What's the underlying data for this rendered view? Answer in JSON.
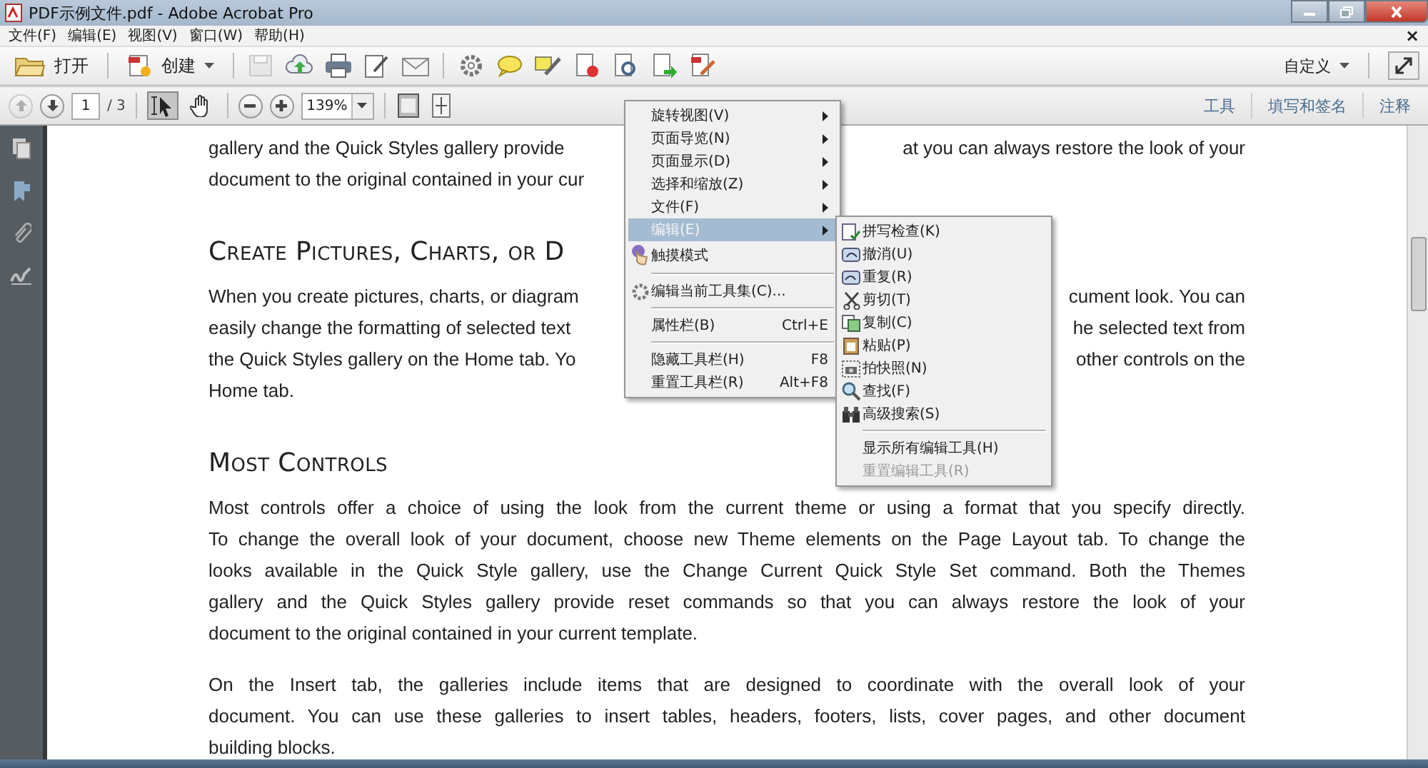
{
  "window": {
    "title": "PDF示例文件.pdf - Adobe Acrobat Pro"
  },
  "menu_bar": {
    "items": [
      "文件(F)",
      "编辑(E)",
      "视图(V)",
      "窗口(W)",
      "帮助(H)"
    ],
    "close_glyph": "×"
  },
  "toolbar": {
    "open_label": "打开",
    "create_label": "创建",
    "tools": [
      {
        "kind": "save",
        "disabled": true
      },
      {
        "kind": "cloud"
      },
      {
        "kind": "print"
      },
      {
        "kind": "sign"
      },
      {
        "kind": "mail"
      },
      {
        "kind": "gear"
      },
      {
        "kind": "comment"
      },
      {
        "kind": "highlight"
      },
      {
        "kind": "pdf-remove"
      },
      {
        "kind": "pdf-search"
      },
      {
        "kind": "pdf-export"
      },
      {
        "kind": "pdf-edit"
      }
    ],
    "customize_label": "自定义"
  },
  "nav_toolbar": {
    "prev_disabled": true,
    "page": "1",
    "page_total": "/ 3",
    "tools": [
      {
        "kind": "select",
        "selected": true
      },
      {
        "kind": "hand",
        "selected": false
      }
    ],
    "zoom": "139%",
    "panes": [
      {
        "label": "工具"
      },
      {
        "label": "填写和签名"
      },
      {
        "label": "注释"
      }
    ]
  },
  "document": {
    "blocks": [
      {
        "kind": "paragraph",
        "lines": [
          {
            "left": "gallery and the Quick Styles gallery provide",
            "right": "at you can always restore the look of your"
          },
          {
            "left": "document to the original contained in your cur"
          }
        ]
      },
      {
        "kind": "heading",
        "text": "Create Pictures, Charts, or D"
      },
      {
        "kind": "paragraph",
        "lines": [
          {
            "left": "When you create pictures, charts, or diagram",
            "right": "cument look. You can"
          },
          {
            "left": "easily change the formatting of selected text",
            "right": "he selected text from"
          },
          {
            "left": "the Quick Styles gallery on the Home tab. Yo",
            "right": "other controls on the"
          },
          {
            "left": "Home tab."
          }
        ]
      },
      {
        "kind": "heading",
        "text": "Most Controls"
      },
      {
        "kind": "paragraph",
        "lines": [
          {
            "left": "Most controls offer a choice of using the look from the current theme or using a format that you specify directly.",
            "justified": true
          },
          {
            "left": "To change the overall look of your document, choose new Theme elements on the Page Layout tab. To change the",
            "justified": true
          },
          {
            "left": "looks available in the Quick Style gallery, use the Change Current Quick Style Set command. Both the Themes",
            "justified": true
          },
          {
            "left": "gallery and the Quick Styles gallery provide reset commands so that you can always restore the look of your",
            "justified": true
          },
          {
            "left": "document to the original contained in your current template.",
            "justified": false
          }
        ]
      },
      {
        "kind": "paragraph",
        "lines": [
          {
            "left": "On the Insert tab, the galleries include items that are designed to coordinate with the overall look of your",
            "justified": true
          },
          {
            "left": "document. You can use these galleries to insert tables, headers, footers, lists, cover pages, and other document",
            "justified": true
          },
          {
            "left": "building blocks.",
            "justified": false
          }
        ]
      }
    ]
  },
  "context_menu": {
    "groups": [
      [
        {
          "label": "旋转视图(V)",
          "submenu": true,
          "selected": false
        },
        {
          "label": "页面导览(N)",
          "submenu": true,
          "selected": false
        },
        {
          "label": "页面显示(D)",
          "submenu": true,
          "selected": false
        },
        {
          "label": "选择和缩放(Z)",
          "submenu": true,
          "selected": false
        },
        {
          "label": "文件(F)",
          "submenu": true,
          "selected": false
        },
        {
          "label": "编辑(E)",
          "submenu": true,
          "selected": true
        },
        {
          "label": "触摸模式",
          "submenu": false,
          "selected": false
        }
      ],
      [
        {
          "label": "编辑当前工具集(C)...",
          "submenu": false,
          "selected": false
        }
      ],
      [
        {
          "label": "属性栏(B)",
          "shortcut": "Ctrl+E",
          "submenu": false,
          "selected": false
        }
      ],
      [
        {
          "label": "隐藏工具栏(H)",
          "shortcut": "F8",
          "submenu": false,
          "selected": false
        },
        {
          "label": "重置工具栏(R)",
          "shortcut": "Alt+F8",
          "submenu": false,
          "selected": false
        }
      ]
    ]
  },
  "submenu": {
    "groups": [
      [
        {
          "label": "拼写检查(K)",
          "disabled": false
        },
        {
          "label": "撤消(U)",
          "disabled": false
        },
        {
          "label": "重复(R)",
          "disabled": false
        },
        {
          "label": "剪切(T)",
          "disabled": false
        },
        {
          "label": "复制(C)",
          "disabled": false
        },
        {
          "label": "粘贴(P)",
          "disabled": false
        },
        {
          "label": "拍快照(N)",
          "disabled": false
        },
        {
          "label": "查找(F)",
          "disabled": false
        },
        {
          "label": "高级搜索(S)",
          "disabled": false
        }
      ],
      [
        {
          "label": "显示所有编辑工具(H)",
          "disabled": false
        },
        {
          "label": "重置编辑工具(R)",
          "disabled": true
        }
      ]
    ]
  }
}
